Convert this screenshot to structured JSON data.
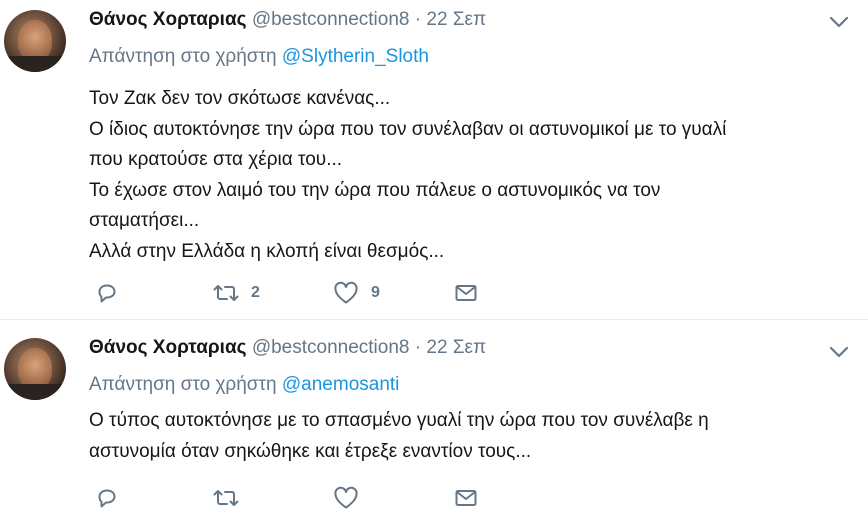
{
  "tweets": [
    {
      "author_name": "Θάνος Χορταριας",
      "handle": "@bestconnection8",
      "separator": "·",
      "date": "22 Σεπ",
      "reply_prefix": "Απάντηση στο χρήστη",
      "reply_mention": "@Slytherin_Sloth",
      "lines": [
        "Τον Ζακ δεν τον σκότωσε κανένας...",
        "Ο ίδιος αυτοκτόνησε την ώρα που τον συνέλαβαν οι αστυνομικοί με το γυαλί",
        "που κρατούσε στα χέρια του...",
        "Το έχωσε στον λαιμό του την ώρα που πάλευε ο αστυνομικός να τον",
        "σταματήσει...",
        "Αλλά στην Ελλάδα η κλοπή είναι θεσμός..."
      ],
      "retweet_count": "2",
      "like_count": "9"
    },
    {
      "author_name": "Θάνος Χορταριας",
      "handle": "@bestconnection8",
      "separator": "·",
      "date": "22 Σεπ",
      "reply_prefix": "Απάντηση στο χρήστη",
      "reply_mention": "@anemosanti",
      "lines": [
        "Ο τύπος αυτοκτόνησε με το σπασμένο γυαλί την ώρα που τον συνέλαβε η",
        "αστυνομία όταν  σηκώθηκε και έτρεξε εναντίον τους..."
      ]
    }
  ],
  "colors": {
    "text": "#14171a",
    "secondary": "#657786",
    "link": "#1b95e0",
    "divider": "#e6ecf0"
  },
  "icons": [
    "chevron-down-icon",
    "reply-icon",
    "retweet-icon",
    "like-icon",
    "direct-message-icon"
  ]
}
